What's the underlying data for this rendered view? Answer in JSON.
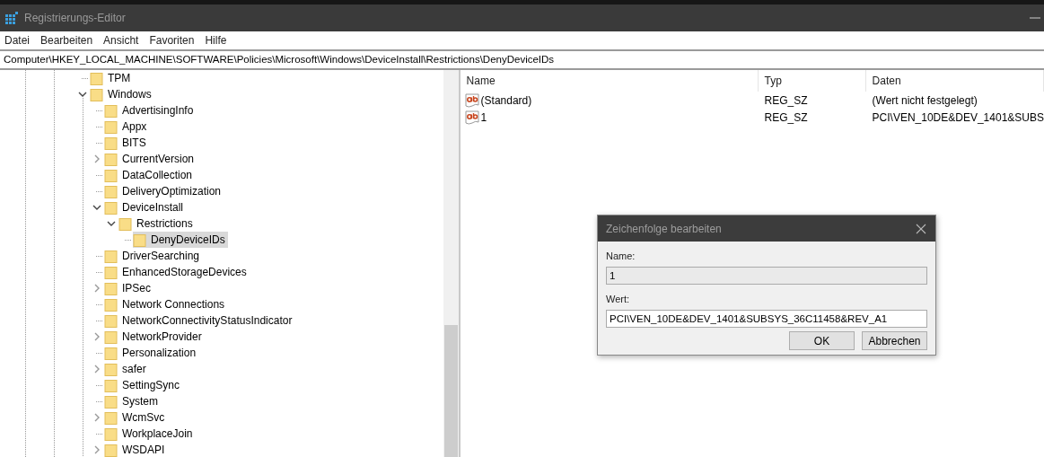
{
  "window": {
    "title": "Registrierungs-Editor"
  },
  "menu": [
    "Datei",
    "Bearbeiten",
    "Ansicht",
    "Favoriten",
    "Hilfe"
  ],
  "address": "Computer\\HKEY_LOCAL_MACHINE\\SOFTWARE\\Policies\\Microsoft\\Windows\\DeviceInstall\\Restrictions\\DenyDeviceIDs",
  "tree": [
    {
      "label": "TPM",
      "kind": "leaf",
      "selected": false
    },
    {
      "label": "Windows",
      "kind": "branch",
      "expanded": true,
      "selected": false,
      "children": [
        {
          "label": "AdvertisingInfo",
          "kind": "leaf",
          "selected": false
        },
        {
          "label": "Appx",
          "kind": "leaf",
          "selected": false
        },
        {
          "label": "BITS",
          "kind": "leaf",
          "selected": false
        },
        {
          "label": "CurrentVersion",
          "kind": "branch",
          "expanded": false,
          "selected": false
        },
        {
          "label": "DataCollection",
          "kind": "leaf",
          "selected": false
        },
        {
          "label": "DeliveryOptimization",
          "kind": "leaf",
          "selected": false
        },
        {
          "label": "DeviceInstall",
          "kind": "branch",
          "expanded": true,
          "selected": false,
          "children": [
            {
              "label": "Restrictions",
              "kind": "branch",
              "expanded": true,
              "selected": false,
              "children": [
                {
                  "label": "DenyDeviceIDs",
                  "kind": "leaf",
                  "selected": true
                }
              ]
            }
          ]
        },
        {
          "label": "DriverSearching",
          "kind": "leaf",
          "selected": false
        },
        {
          "label": "EnhancedStorageDevices",
          "kind": "leaf",
          "selected": false
        },
        {
          "label": "IPSec",
          "kind": "branch",
          "expanded": false,
          "selected": false
        },
        {
          "label": "Network Connections",
          "kind": "leaf",
          "selected": false
        },
        {
          "label": "NetworkConnectivityStatusIndicator",
          "kind": "leaf",
          "selected": false
        },
        {
          "label": "NetworkProvider",
          "kind": "branch",
          "expanded": false,
          "selected": false
        },
        {
          "label": "Personalization",
          "kind": "leaf",
          "selected": false
        },
        {
          "label": "safer",
          "kind": "branch",
          "expanded": false,
          "selected": false
        },
        {
          "label": "SettingSync",
          "kind": "leaf",
          "selected": false
        },
        {
          "label": "System",
          "kind": "leaf",
          "selected": false
        },
        {
          "label": "WcmSvc",
          "kind": "branch",
          "expanded": false,
          "selected": false
        },
        {
          "label": "WorkplaceJoin",
          "kind": "leaf",
          "selected": false
        },
        {
          "label": "WSDAPI",
          "kind": "branch",
          "expanded": false,
          "selected": false
        }
      ]
    }
  ],
  "values": {
    "columns": [
      "Name",
      "Typ",
      "Daten"
    ],
    "rows": [
      {
        "name": "(Standard)",
        "type": "REG_SZ",
        "data": "(Wert nicht festgelegt)"
      },
      {
        "name": "1",
        "type": "REG_SZ",
        "data": "PCI\\VEN_10DE&DEV_1401&SUBS"
      }
    ]
  },
  "dialog": {
    "title": "Zeichenfolge bearbeiten",
    "name_label": "Name:",
    "name_value": "1",
    "value_label": "Wert:",
    "value": "PCI\\VEN_10DE&DEV_1401&SUBSYS_36C11458&REV_A1",
    "buttons": [
      "OK",
      "Abbrechen"
    ]
  }
}
